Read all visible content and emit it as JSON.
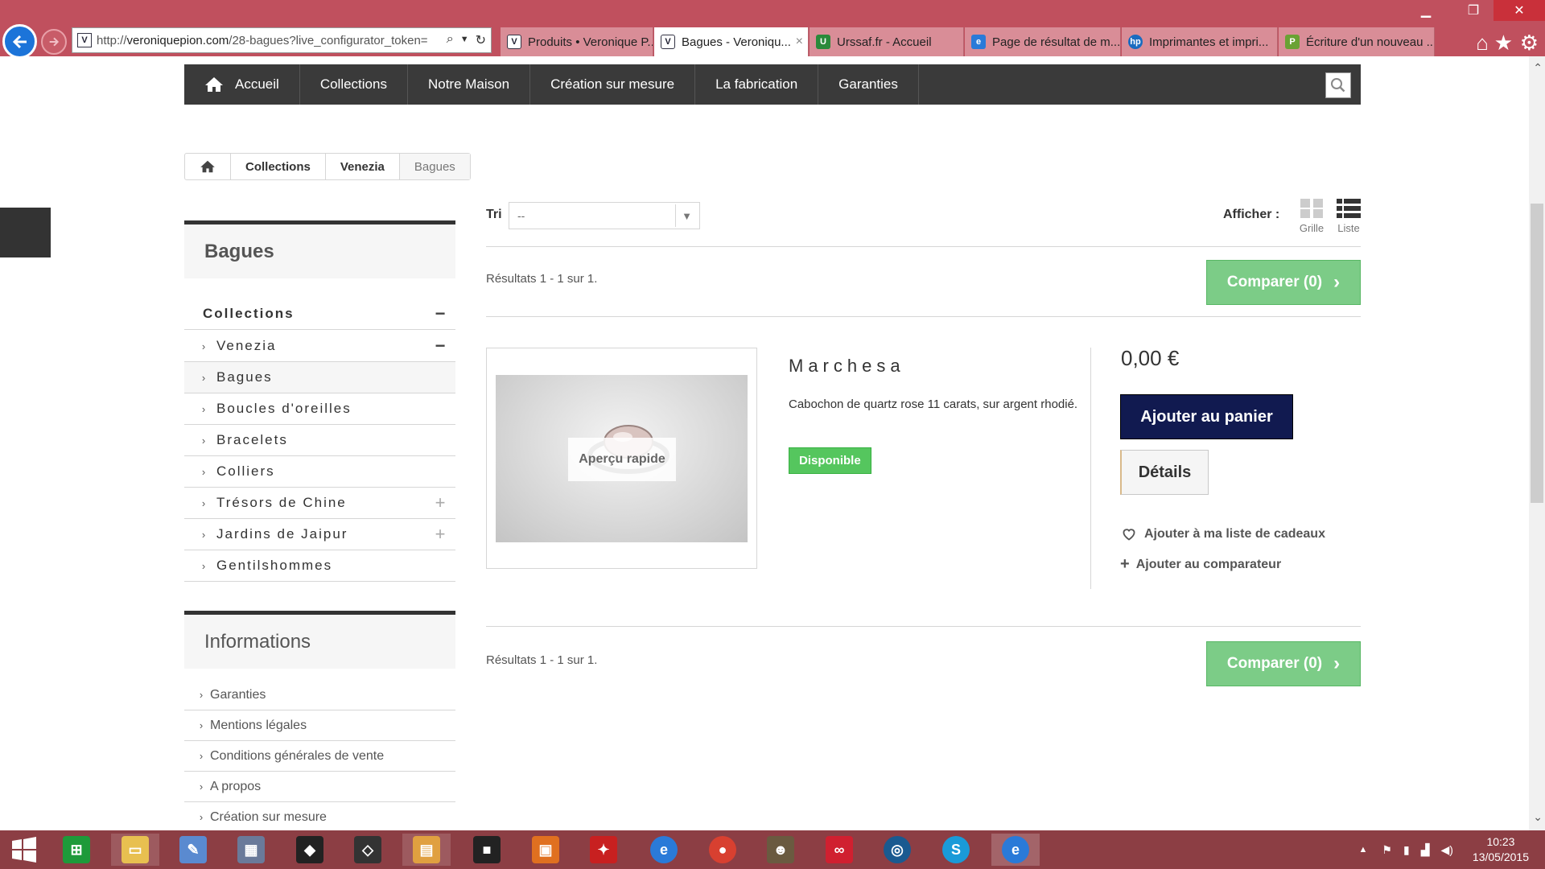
{
  "browser": {
    "url_prefix": "http://",
    "url_domain": "veroniquepion.com",
    "url_path": "/28-bagues?live_configurator_token=",
    "tabs": [
      {
        "label": "Produits • Veronique P..."
      },
      {
        "label": "Bagues - Veroniqu..."
      },
      {
        "label": "Urssaf.fr - Accueil"
      },
      {
        "label": "Page de résultat de m..."
      },
      {
        "label": "Imprimantes et impri..."
      },
      {
        "label": "Écriture d'un nouveau ..."
      }
    ],
    "active_tab_close": "×"
  },
  "nav": {
    "items": [
      "Accueil",
      "Collections",
      "Notre Maison",
      "Création sur mesure",
      "La fabrication",
      "Garanties"
    ]
  },
  "breadcrumb": [
    "Collections",
    "Venezia",
    "Bagues"
  ],
  "sidebar": {
    "title": "Bagues",
    "categories": [
      {
        "label": "Collections",
        "toggle": "−"
      },
      {
        "label": "Venezia",
        "toggle": "−"
      },
      {
        "label": "Bagues",
        "toggle": ""
      },
      {
        "label": "Boucles d'oreilles",
        "toggle": ""
      },
      {
        "label": "Bracelets",
        "toggle": ""
      },
      {
        "label": "Colliers",
        "toggle": ""
      },
      {
        "label": "Trésors de Chine",
        "toggle": "+"
      },
      {
        "label": "Jardins de Jaipur",
        "toggle": "+"
      },
      {
        "label": "Gentilshommes",
        "toggle": ""
      }
    ],
    "info_title": "Informations",
    "info_items": [
      "Garanties",
      "Mentions légales",
      "Conditions générales de vente",
      "A propos",
      "Création sur mesure"
    ]
  },
  "toolbar": {
    "sort_label": "Tri",
    "sort_value": "--",
    "display_label": "Afficher :",
    "grid_label": "Grille",
    "list_label": "Liste"
  },
  "results": {
    "top": "Résultats 1 - 1 sur 1.",
    "bottom": "Résultats 1 - 1 sur 1.",
    "compare_label": "Comparer (0)"
  },
  "product": {
    "name": "Marchesa",
    "description": "Cabochon de quartz rose 11 carats, sur argent rhodié.",
    "availability": "Disponible",
    "price": "0,00 €",
    "quick_view": "Aperçu rapide",
    "add_to_cart": "Ajouter au panier",
    "details": "Détails",
    "wishlist": "Ajouter à ma liste de cadeaux",
    "compare": "Ajouter au comparateur"
  },
  "taskbar": {
    "time": "10:23",
    "date": "13/05/2015"
  },
  "colors": {
    "chrome": "#c0505e",
    "nav_bg": "#3a3a3a",
    "compare_green": "#7ccc87",
    "cart_navy": "#111a50",
    "avail_green": "#55c65e",
    "taskbar": "#8c3e44"
  }
}
